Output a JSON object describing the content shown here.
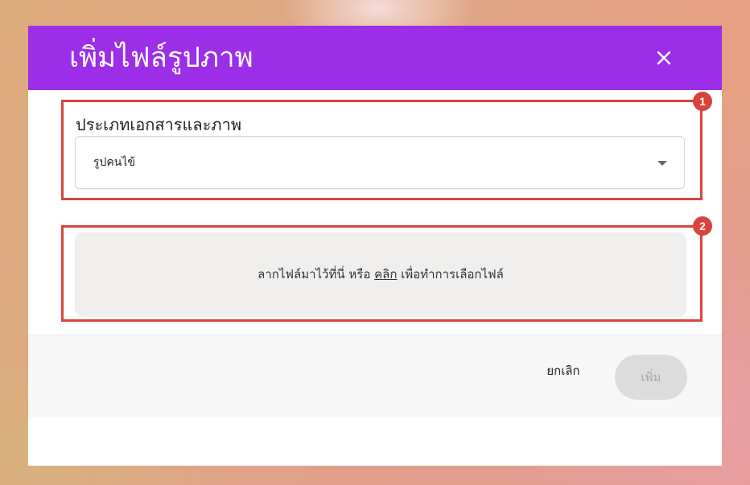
{
  "dialog": {
    "title": "เพิ่มไฟล์รูปภาพ",
    "header_color": "#9c2ee8",
    "close_icon": "close-icon"
  },
  "form": {
    "document_type_label": "ประเภทเอกสารและภาพ",
    "document_type_value": "รูปคนไข้"
  },
  "dropzone": {
    "text_before": "ลากไฟล์มาไว้ที่นี่ หรือ ",
    "link_text": "คลิก",
    "text_after": " เพื่อทำการเลือกไฟล์"
  },
  "footer": {
    "cancel_label": "ยกเลิก",
    "add_label": "เพิ่ม"
  },
  "annotations": {
    "badge_1": "1",
    "badge_2": "2",
    "color": "#d9433d"
  }
}
